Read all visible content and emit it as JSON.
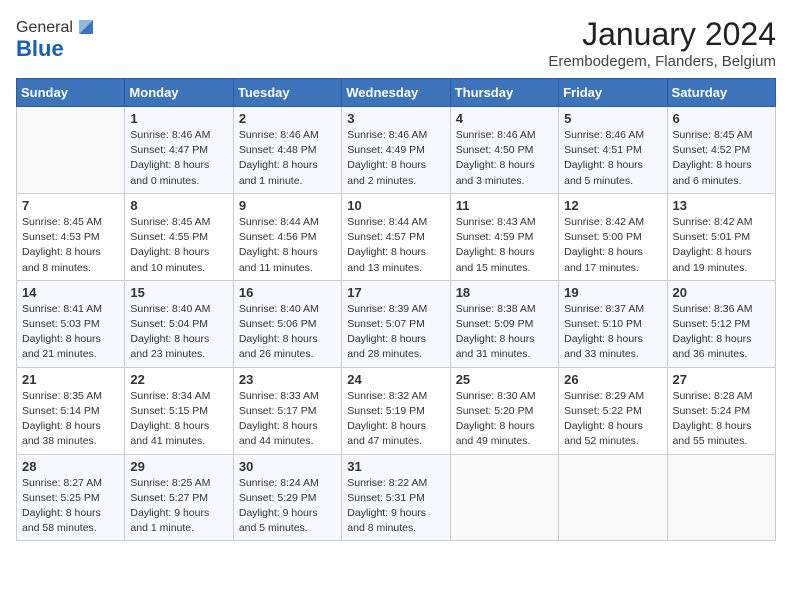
{
  "logo": {
    "general": "General",
    "blue": "Blue"
  },
  "header": {
    "month": "January 2024",
    "location": "Erembodegem, Flanders, Belgium"
  },
  "weekdays": [
    "Sunday",
    "Monday",
    "Tuesday",
    "Wednesday",
    "Thursday",
    "Friday",
    "Saturday"
  ],
  "weeks": [
    [
      {
        "day": "",
        "sunrise": "",
        "sunset": "",
        "daylight": ""
      },
      {
        "day": "1",
        "sunrise": "Sunrise: 8:46 AM",
        "sunset": "Sunset: 4:47 PM",
        "daylight": "Daylight: 8 hours and 0 minutes."
      },
      {
        "day": "2",
        "sunrise": "Sunrise: 8:46 AM",
        "sunset": "Sunset: 4:48 PM",
        "daylight": "Daylight: 8 hours and 1 minute."
      },
      {
        "day": "3",
        "sunrise": "Sunrise: 8:46 AM",
        "sunset": "Sunset: 4:49 PM",
        "daylight": "Daylight: 8 hours and 2 minutes."
      },
      {
        "day": "4",
        "sunrise": "Sunrise: 8:46 AM",
        "sunset": "Sunset: 4:50 PM",
        "daylight": "Daylight: 8 hours and 3 minutes."
      },
      {
        "day": "5",
        "sunrise": "Sunrise: 8:46 AM",
        "sunset": "Sunset: 4:51 PM",
        "daylight": "Daylight: 8 hours and 5 minutes."
      },
      {
        "day": "6",
        "sunrise": "Sunrise: 8:45 AM",
        "sunset": "Sunset: 4:52 PM",
        "daylight": "Daylight: 8 hours and 6 minutes."
      }
    ],
    [
      {
        "day": "7",
        "sunrise": "Sunrise: 8:45 AM",
        "sunset": "Sunset: 4:53 PM",
        "daylight": "Daylight: 8 hours and 8 minutes."
      },
      {
        "day": "8",
        "sunrise": "Sunrise: 8:45 AM",
        "sunset": "Sunset: 4:55 PM",
        "daylight": "Daylight: 8 hours and 10 minutes."
      },
      {
        "day": "9",
        "sunrise": "Sunrise: 8:44 AM",
        "sunset": "Sunset: 4:56 PM",
        "daylight": "Daylight: 8 hours and 11 minutes."
      },
      {
        "day": "10",
        "sunrise": "Sunrise: 8:44 AM",
        "sunset": "Sunset: 4:57 PM",
        "daylight": "Daylight: 8 hours and 13 minutes."
      },
      {
        "day": "11",
        "sunrise": "Sunrise: 8:43 AM",
        "sunset": "Sunset: 4:59 PM",
        "daylight": "Daylight: 8 hours and 15 minutes."
      },
      {
        "day": "12",
        "sunrise": "Sunrise: 8:42 AM",
        "sunset": "Sunset: 5:00 PM",
        "daylight": "Daylight: 8 hours and 17 minutes."
      },
      {
        "day": "13",
        "sunrise": "Sunrise: 8:42 AM",
        "sunset": "Sunset: 5:01 PM",
        "daylight": "Daylight: 8 hours and 19 minutes."
      }
    ],
    [
      {
        "day": "14",
        "sunrise": "Sunrise: 8:41 AM",
        "sunset": "Sunset: 5:03 PM",
        "daylight": "Daylight: 8 hours and 21 minutes."
      },
      {
        "day": "15",
        "sunrise": "Sunrise: 8:40 AM",
        "sunset": "Sunset: 5:04 PM",
        "daylight": "Daylight: 8 hours and 23 minutes."
      },
      {
        "day": "16",
        "sunrise": "Sunrise: 8:40 AM",
        "sunset": "Sunset: 5:06 PM",
        "daylight": "Daylight: 8 hours and 26 minutes."
      },
      {
        "day": "17",
        "sunrise": "Sunrise: 8:39 AM",
        "sunset": "Sunset: 5:07 PM",
        "daylight": "Daylight: 8 hours and 28 minutes."
      },
      {
        "day": "18",
        "sunrise": "Sunrise: 8:38 AM",
        "sunset": "Sunset: 5:09 PM",
        "daylight": "Daylight: 8 hours and 31 minutes."
      },
      {
        "day": "19",
        "sunrise": "Sunrise: 8:37 AM",
        "sunset": "Sunset: 5:10 PM",
        "daylight": "Daylight: 8 hours and 33 minutes."
      },
      {
        "day": "20",
        "sunrise": "Sunrise: 8:36 AM",
        "sunset": "Sunset: 5:12 PM",
        "daylight": "Daylight: 8 hours and 36 minutes."
      }
    ],
    [
      {
        "day": "21",
        "sunrise": "Sunrise: 8:35 AM",
        "sunset": "Sunset: 5:14 PM",
        "daylight": "Daylight: 8 hours and 38 minutes."
      },
      {
        "day": "22",
        "sunrise": "Sunrise: 8:34 AM",
        "sunset": "Sunset: 5:15 PM",
        "daylight": "Daylight: 8 hours and 41 minutes."
      },
      {
        "day": "23",
        "sunrise": "Sunrise: 8:33 AM",
        "sunset": "Sunset: 5:17 PM",
        "daylight": "Daylight: 8 hours and 44 minutes."
      },
      {
        "day": "24",
        "sunrise": "Sunrise: 8:32 AM",
        "sunset": "Sunset: 5:19 PM",
        "daylight": "Daylight: 8 hours and 47 minutes."
      },
      {
        "day": "25",
        "sunrise": "Sunrise: 8:30 AM",
        "sunset": "Sunset: 5:20 PM",
        "daylight": "Daylight: 8 hours and 49 minutes."
      },
      {
        "day": "26",
        "sunrise": "Sunrise: 8:29 AM",
        "sunset": "Sunset: 5:22 PM",
        "daylight": "Daylight: 8 hours and 52 minutes."
      },
      {
        "day": "27",
        "sunrise": "Sunrise: 8:28 AM",
        "sunset": "Sunset: 5:24 PM",
        "daylight": "Daylight: 8 hours and 55 minutes."
      }
    ],
    [
      {
        "day": "28",
        "sunrise": "Sunrise: 8:27 AM",
        "sunset": "Sunset: 5:25 PM",
        "daylight": "Daylight: 8 hours and 58 minutes."
      },
      {
        "day": "29",
        "sunrise": "Sunrise: 8:25 AM",
        "sunset": "Sunset: 5:27 PM",
        "daylight": "Daylight: 9 hours and 1 minute."
      },
      {
        "day": "30",
        "sunrise": "Sunrise: 8:24 AM",
        "sunset": "Sunset: 5:29 PM",
        "daylight": "Daylight: 9 hours and 5 minutes."
      },
      {
        "day": "31",
        "sunrise": "Sunrise: 8:22 AM",
        "sunset": "Sunset: 5:31 PM",
        "daylight": "Daylight: 9 hours and 8 minutes."
      },
      {
        "day": "",
        "sunrise": "",
        "sunset": "",
        "daylight": ""
      },
      {
        "day": "",
        "sunrise": "",
        "sunset": "",
        "daylight": ""
      },
      {
        "day": "",
        "sunrise": "",
        "sunset": "",
        "daylight": ""
      }
    ]
  ]
}
